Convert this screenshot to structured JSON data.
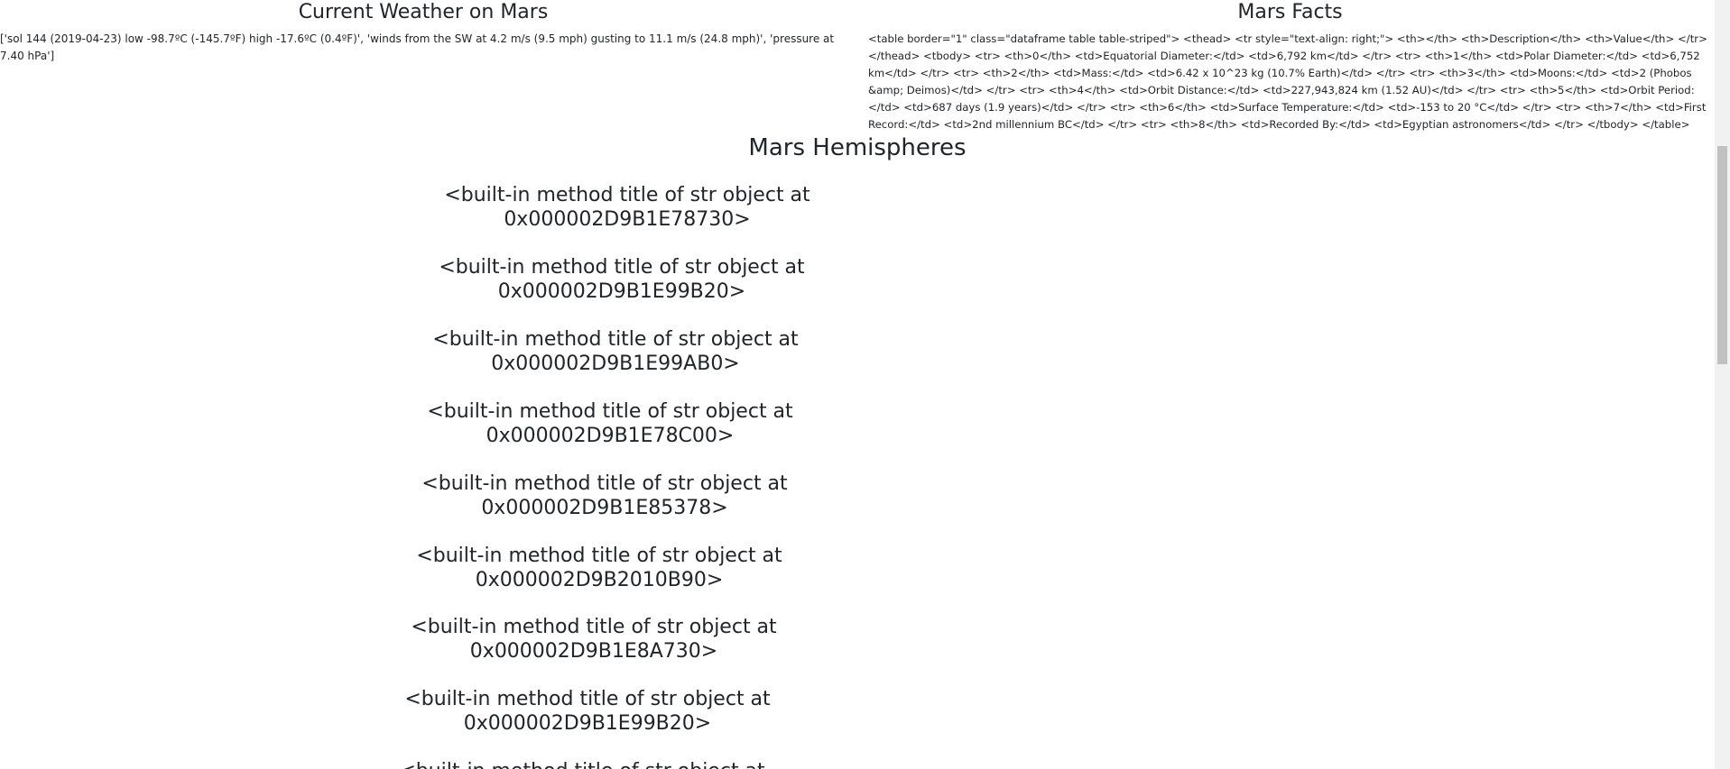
{
  "weather": {
    "heading": "Current Weather on Mars",
    "text": "['sol 144 (2019-04-23) low -98.7ºC (-145.7ºF) high -17.6ºC (0.4ºF)', 'winds from the SW at 4.2 m/s (9.5 mph) gusting to 11.1 m/s (24.8 mph)', 'pressure at 7.40 hPa']"
  },
  "facts": {
    "heading": "Mars Facts",
    "text": "<table border=\"1\" class=\"dataframe table table-striped\"> <thead> <tr style=\"text-align: right;\"> <th></th> <th>Description</th> <th>Value</th> </tr> </thead> <tbody> <tr> <th>0</th> <td>Equatorial Diameter:</td> <td>6,792 km</td> </tr> <tr> <th>1</th> <td>Polar Diameter:</td> <td>6,752 km</td> </tr> <tr> <th>2</th> <td>Mass:</td> <td>6.42 x 10^23 kg (10.7% Earth)</td> </tr> <tr> <th>3</th> <td>Moons:</td> <td>2 (Phobos &amp; Deimos)</td> </tr> <tr> <th>4</th> <td>Orbit Distance:</td> <td>227,943,824 km (1.52 AU)</td> </tr> <tr> <th>5</th> <td>Orbit Period:</td> <td>687 days (1.9 years)</td> </tr> <tr> <th>6</th> <td>Surface Temperature:</td> <td>-153 to 20 °C</td> </tr> <tr> <th>7</th> <td>First Record:</td> <td>2nd millennium BC</td> </tr> <tr> <th>8</th> <td>Recorded By:</td> <td>Egyptian astronomers</td> </tr> </tbody> </table>"
  },
  "hemispheres": {
    "heading": "Mars Hemispheres",
    "items": [
      "<built-in method title of str object at 0x000002D9B1E78730>",
      "<built-in method title of str object at 0x000002D9B1E99B20>",
      "<built-in method title of str object at 0x000002D9B1E99AB0>",
      "<built-in method title of str object at 0x000002D9B1E78C00>",
      "<built-in method title of str object at 0x000002D9B1E85378>",
      "<built-in method title of str object at 0x000002D9B2010B90>",
      "<built-in method title of str object at 0x000002D9B1E8A730>",
      "<built-in method title of str object at 0x000002D9B1E99B20>",
      "<built-in method title of str object at"
    ]
  }
}
